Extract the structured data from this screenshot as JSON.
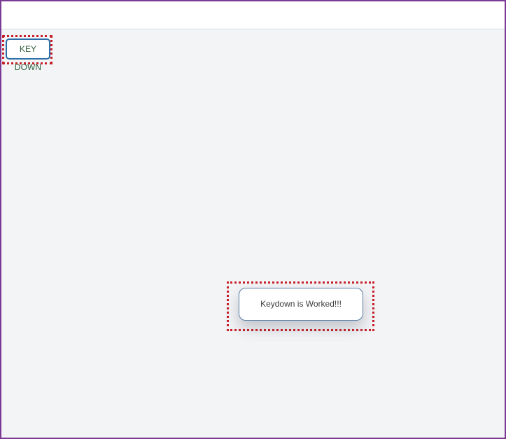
{
  "buttons": {
    "key_down_label": "KEY DOWN"
  },
  "toast": {
    "message": "Keydown is Worked!!!"
  },
  "colors": {
    "frame_border": "#7b3a93",
    "highlight": "#c8202a",
    "button_border": "#2b6ea8",
    "background": "#f3f4f6"
  }
}
